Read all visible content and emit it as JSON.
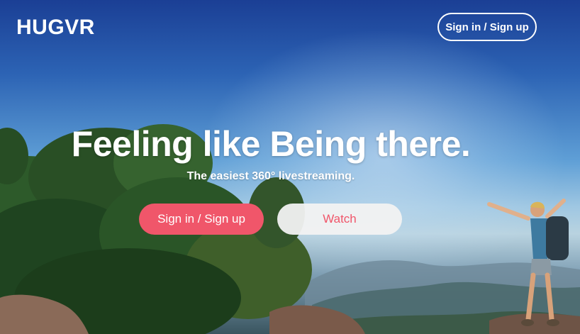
{
  "brand": {
    "logo_text": "HUGVR"
  },
  "header": {
    "signin_label": "Sign in / Sign up"
  },
  "hero": {
    "headline": "Feeling like Being there.",
    "subline": "The easiest 360° livestreaming.",
    "primary_cta_label": "Sign in / Sign up",
    "secondary_cta_label": "Watch"
  },
  "colors": {
    "accent": "#f0566a",
    "sky_top": "#1b3f95",
    "watch_bg": "#f2f2f2",
    "text": "#ffffff"
  },
  "imagery": {
    "background": "mountain-landscape-photo",
    "figure": "hiker-with-raised-arms"
  }
}
